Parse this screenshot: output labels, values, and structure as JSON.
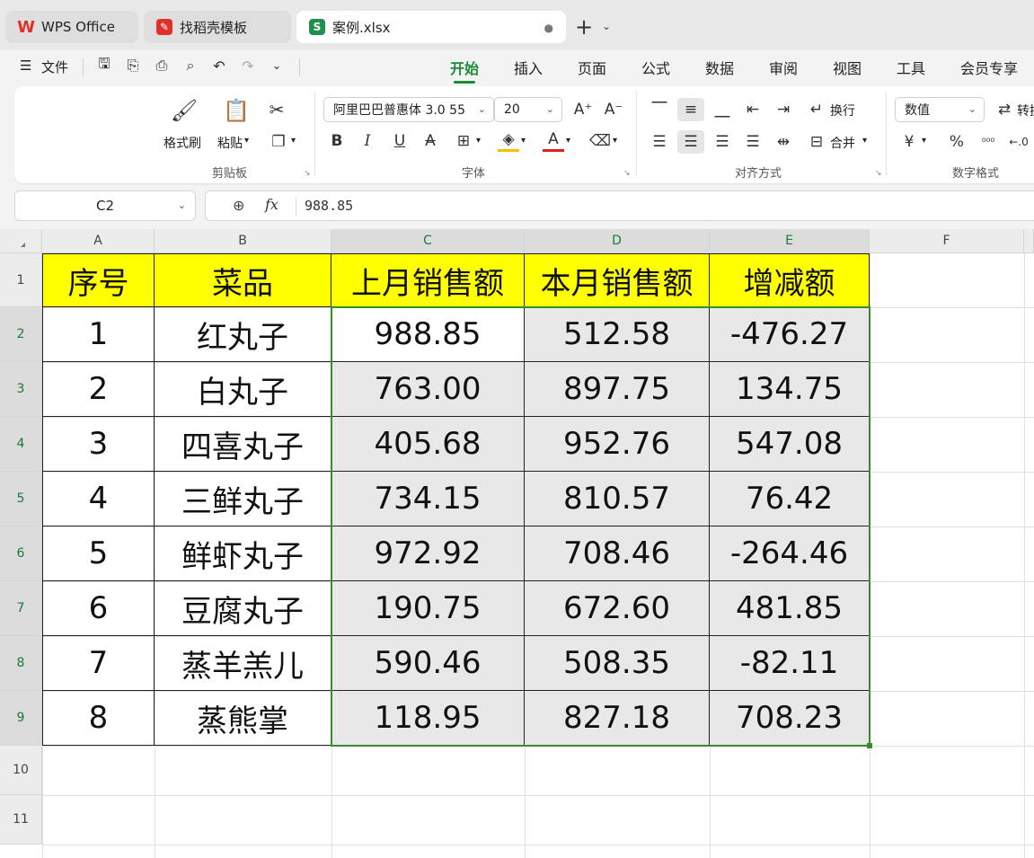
{
  "tabs": [
    {
      "label": "WPS Office",
      "icon": "wps-logo-icon",
      "color": "#e0302b"
    },
    {
      "label": "找稻壳模板",
      "icon": "docer-icon",
      "color": "#e0302b"
    },
    {
      "label": "案例.xlsx",
      "icon": "spreadsheet-file-icon",
      "color": "#1f8f4e",
      "icon_letter": "S",
      "modified_dot": "●"
    }
  ],
  "new_tab": "+",
  "menu": {
    "hamburger": "☰",
    "file": "文件",
    "ribbon_tabs": [
      "开始",
      "插入",
      "页面",
      "公式",
      "数据",
      "审阅",
      "视图",
      "工具",
      "会员专享"
    ],
    "active_tab": "开始"
  },
  "ribbon": {
    "clipboard": {
      "format_painter": "格式刷",
      "paste": "粘贴",
      "group": "剪贴板"
    },
    "font": {
      "name": "阿里巴巴普惠体 3.0 55",
      "size": "20",
      "group": "字体"
    },
    "align": {
      "wrap": "换行",
      "merge": "合并",
      "group": "对齐方式"
    },
    "number": {
      "format": "数值",
      "convert": "转换",
      "group": "数字格式",
      "currency": "¥"
    }
  },
  "formula_bar": {
    "cell_ref": "C2",
    "fx": "fx",
    "value": "988.85"
  },
  "sheet": {
    "columns": [
      "A",
      "B",
      "C",
      "D",
      "E",
      "F"
    ],
    "rows": [
      "1",
      "2",
      "3",
      "4",
      "5",
      "6",
      "7",
      "8",
      "9",
      "10",
      "11"
    ],
    "header": [
      "序号",
      "菜品",
      "上月销售额",
      "本月销售额",
      "增减额"
    ],
    "data": [
      [
        "1",
        "红丸子",
        "988.85",
        "512.58",
        "-476.27"
      ],
      [
        "2",
        "白丸子",
        "763.00",
        "897.75",
        "134.75"
      ],
      [
        "3",
        "四喜丸子",
        "405.68",
        "952.76",
        "547.08"
      ],
      [
        "4",
        "三鲜丸子",
        "734.15",
        "810.57",
        "76.42"
      ],
      [
        "5",
        "鲜虾丸子",
        "972.92",
        "708.46",
        "-264.46"
      ],
      [
        "6",
        "豆腐丸子",
        "190.75",
        "672.60",
        "481.85"
      ],
      [
        "7",
        "蒸羊羔儿",
        "590.46",
        "508.35",
        "-82.11"
      ],
      [
        "8",
        "蒸熊掌",
        "118.95",
        "827.18",
        "708.23"
      ]
    ]
  },
  "colors": {
    "accent": "#1b8a3c",
    "header_fill": "#ffff00",
    "selection": "#3a8a2e",
    "shade": "#e8e8e8"
  }
}
